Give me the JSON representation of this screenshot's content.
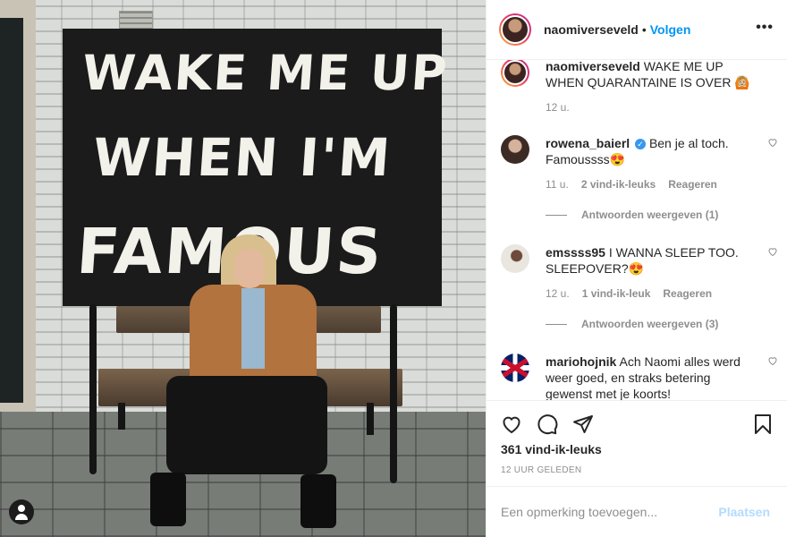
{
  "photo": {
    "sign_lines": [
      "WAKE ME UP",
      "WHEN I'M",
      "FAMOUS"
    ],
    "user_tag_icon": "person-icon"
  },
  "header": {
    "username": "naomiverseveld",
    "separator": "•",
    "follow_label": "Volgen",
    "more_icon": "more-options-icon",
    "more_glyph": "•••"
  },
  "caption": {
    "username": "naomiverseveld",
    "text": "WAKE ME UP WHEN QUARANTAINE IS OVER 🙆🏼",
    "time": "12 u."
  },
  "comments": [
    {
      "username": "rowena_baierl",
      "verified": true,
      "verified_glyph": "✓",
      "text": "Ben je al toch. Famoussss😍",
      "time": "11 u.",
      "likes": "2 vind-ik-leuks",
      "reply_label": "Reageren",
      "view_replies": "Antwoorden weergeven (1)"
    },
    {
      "username": "emssss95",
      "text": "I WANNA SLEEP TOO. SLEEPOVER?😍",
      "time": "12 u.",
      "likes": "1 vind-ik-leuk",
      "reply_label": "Reageren",
      "view_replies": "Antwoorden weergeven (3)"
    },
    {
      "username": "mariohojnik",
      "text": "Ach Naomi alles werd weer goed, en straks betering gewenst met je koorts!"
    }
  ],
  "actions": {
    "icons": [
      "heart-icon",
      "comment-icon",
      "share-icon",
      "bookmark-icon"
    ],
    "likes": "361 vind-ik-leuks",
    "posted_ago": "12 UUR GELEDEN"
  },
  "add_comment": {
    "placeholder": "Een opmerking toevoegen...",
    "post_label": "Plaatsen"
  },
  "colors": {
    "link_blue": "#0095f6",
    "post_disabled": "#b3dbff",
    "secondary_text": "#8e8e8e",
    "verified_blue": "#3897f0"
  }
}
